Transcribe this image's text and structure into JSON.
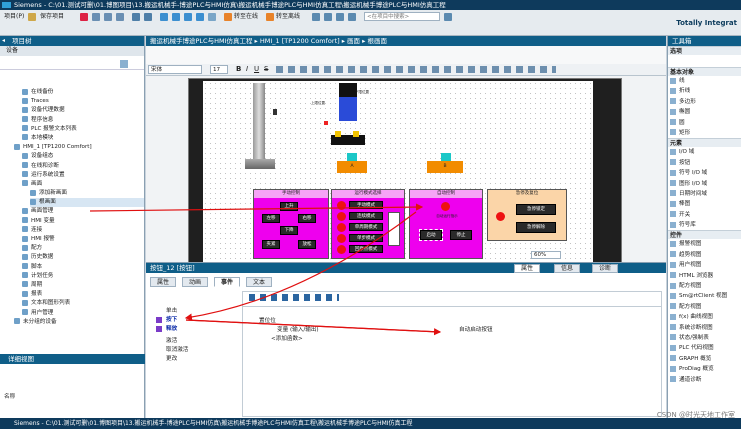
{
  "window": {
    "title": "Siemens - C:\\01.测试可删\\01.博图项目\\13.搬运机械手-博途PLC与HMI仿真\\搬运机械手博途PLC与HMI仿真工程\\搬运机械手博途PLC与HMI仿真工程"
  },
  "toolbar": {
    "project_menu": "项目(P)",
    "save_project": "保存项目",
    "go_online": "转至在线",
    "go_offline": "转至离线",
    "search_placeholder": "<在项目中搜索>",
    "brand": "Totally Integrat"
  },
  "project_tree": {
    "title": "项目树",
    "device_tab": "设备",
    "items": [
      "在线备份",
      "Traces",
      "设备代理数据",
      "程序信息",
      "PLC 报警文本列表",
      "本地模块",
      "HMI_1 [TP1200 Comfort]",
      "设备组态",
      "在线和诊断",
      "运行系统设置",
      "画面",
      "添加新画面",
      "根画面",
      "画面管理",
      "HMI 变量",
      "连接",
      "HMI 报警",
      "配方",
      "历史数据",
      "脚本",
      "计划任务",
      "周期",
      "报表",
      "文本和图形列表",
      "用户管理",
      "未分组的设备"
    ],
    "details_title": "详细视图",
    "details_col": "名称"
  },
  "editor": {
    "breadcrumb": "搬运机械手博途PLC与HMI仿真工程 ▸ HMI_1 [TP1200 Comfort] ▸ 画面 ▸ 根画面",
    "font_name": "宋体",
    "font_size": "17",
    "zoom": "60%",
    "hmi": {
      "label_top1": "下限位置",
      "label_top2": "上限位置",
      "tag_a": "A",
      "tag_b": "B",
      "panel1": {
        "title": "手动控制",
        "b1": "上升",
        "b2": "左移",
        "b3": "右移",
        "b4": "下降",
        "b5": "夹紧",
        "b6": "放松"
      },
      "panel2": {
        "title": "运行模式选择",
        "b1": "手动模式",
        "b2": "连续模式",
        "b3": "单周期模式",
        "b4": "单步模式",
        "b5": "回原点模式"
      },
      "panel3": {
        "title": "自动控制",
        "status": "自动运行指示",
        "b1": "启动",
        "b2": "停止"
      },
      "panel4": {
        "title": "急停及复位",
        "b1": "急停锁定",
        "b2": "急停解除"
      }
    }
  },
  "properties": {
    "title": "按钮_12 [按钮]",
    "tabs": [
      "属性",
      "动画",
      "事件",
      "文本"
    ],
    "right_tabs": [
      "属性",
      "信息",
      "诊断"
    ],
    "events": [
      "单击",
      "按下",
      "释放",
      "激活",
      "取消激活",
      "更改"
    ],
    "function_list": {
      "row1": "置位位",
      "row2": "变量 (输入/输出)",
      "row2_value": "自动启动按钮",
      "row3": "<添加函数>"
    }
  },
  "toolbox": {
    "title": "工具箱",
    "options": "选项",
    "basic_objects_title": "基本对象",
    "basic_objects": [
      "线",
      "折线",
      "多边形",
      "椭圆",
      "圆",
      "矩形"
    ],
    "elements_title": "元素",
    "elements": [
      "I/O 域",
      "按钮",
      "符号 I/O 域",
      "图形 I/O 域",
      "日期时间域",
      "棒图",
      "开关",
      "符号库"
    ],
    "controls_title": "控件",
    "controls": [
      "报警视图",
      "趋势视图",
      "用户视图",
      "HTML 浏览器",
      "配方视图",
      "Sm@rtClient 视图",
      "配方视图",
      "f(x) 曲线视图",
      "系统诊断视图",
      "状态/强制表",
      "PLC 代码视图",
      "GRAPH 概览",
      "ProDiag 概览",
      "通道诊断"
    ]
  },
  "statusbar": {
    "text": "Siemens - C:\\01.测试可删\\01.博图项目\\13.搬运机械手-博途PLC与HMI仿真\\搬运机械手博途PLC与HMI仿真工程\\搬运机械手博途PLC与HMI仿真工程"
  },
  "watermark": "CSDN @时光天地工作室"
}
